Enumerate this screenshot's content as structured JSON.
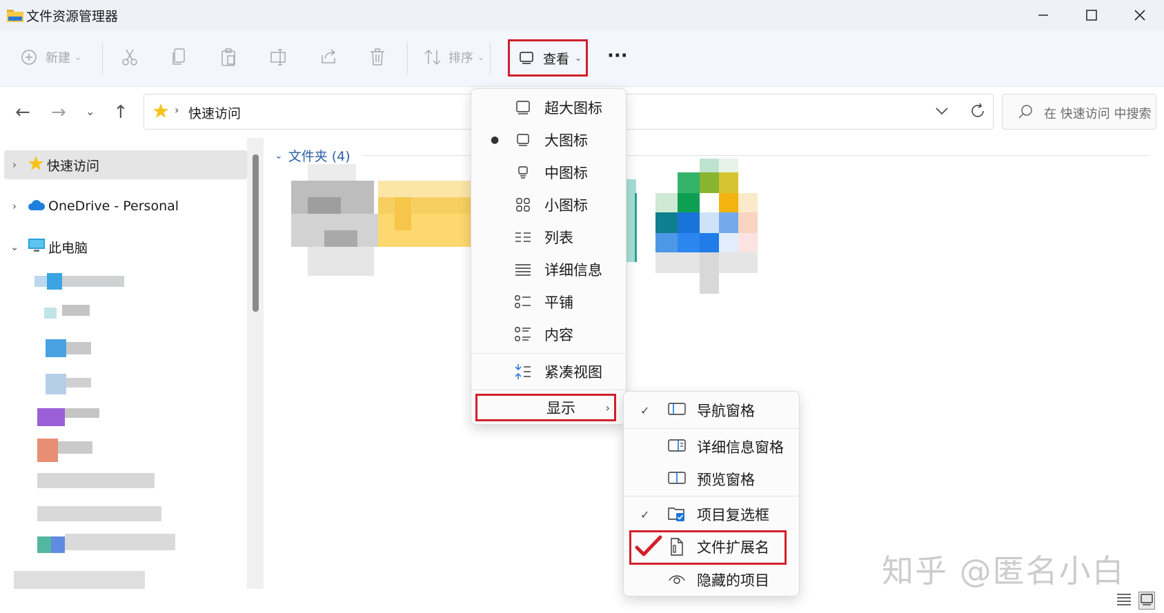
{
  "window": {
    "title": "文件资源管理器",
    "minimize_icon": "minimize-icon",
    "maximize_icon": "maximize-icon",
    "close_icon": "close-icon"
  },
  "commandbar": {
    "new_label": "新建",
    "sort_label": "排序",
    "view_label": "查看",
    "more_label": "···"
  },
  "address": {
    "location": "快速访问",
    "search_placeholder": "在 快速访问 中搜索"
  },
  "sidebar": {
    "items": [
      {
        "label": "快速访问",
        "icon": "star-icon",
        "expanded": false,
        "selected": true
      },
      {
        "label": "OneDrive - Personal",
        "icon": "cloud-icon",
        "expanded": false,
        "selected": false
      },
      {
        "label": "此电脑",
        "icon": "computer-icon",
        "expanded": true,
        "selected": false
      }
    ]
  },
  "content": {
    "group_header": "文件夹 (4)"
  },
  "view_menu": {
    "items": [
      {
        "label": "超大图标",
        "icon": "extra-large-icons-icon",
        "selected": false
      },
      {
        "label": "大图标",
        "icon": "large-icons-icon",
        "selected": true
      },
      {
        "label": "中图标",
        "icon": "medium-icons-icon",
        "selected": false
      },
      {
        "label": "小图标",
        "icon": "small-icons-icon",
        "selected": false
      },
      {
        "label": "列表",
        "icon": "list-icon",
        "selected": false
      },
      {
        "label": "详细信息",
        "icon": "details-icon",
        "selected": false
      },
      {
        "label": "平铺",
        "icon": "tiles-icon",
        "selected": false
      },
      {
        "label": "内容",
        "icon": "content-icon",
        "selected": false
      },
      {
        "label": "紧凑视图",
        "icon": "compact-view-icon",
        "selected": false
      }
    ],
    "show_label": "显示"
  },
  "show_submenu": {
    "items": [
      {
        "label": "导航窗格",
        "icon": "navigation-pane-icon",
        "checked": true
      },
      {
        "label": "详细信息窗格",
        "icon": "details-pane-icon",
        "checked": false
      },
      {
        "label": "预览窗格",
        "icon": "preview-pane-icon",
        "checked": false
      },
      {
        "label": "项目复选框",
        "icon": "item-checkboxes-icon",
        "checked": true
      },
      {
        "label": "文件扩展名",
        "icon": "file-extension-icon",
        "checked": false
      },
      {
        "label": "隐藏的项目",
        "icon": "hidden-items-icon",
        "checked": false
      }
    ]
  },
  "watermark": "知乎 @匿名小白",
  "colors": {
    "accent_red": "#d1202a",
    "folder_yellow": "#f7c948",
    "link_blue": "#2a5fa8"
  }
}
